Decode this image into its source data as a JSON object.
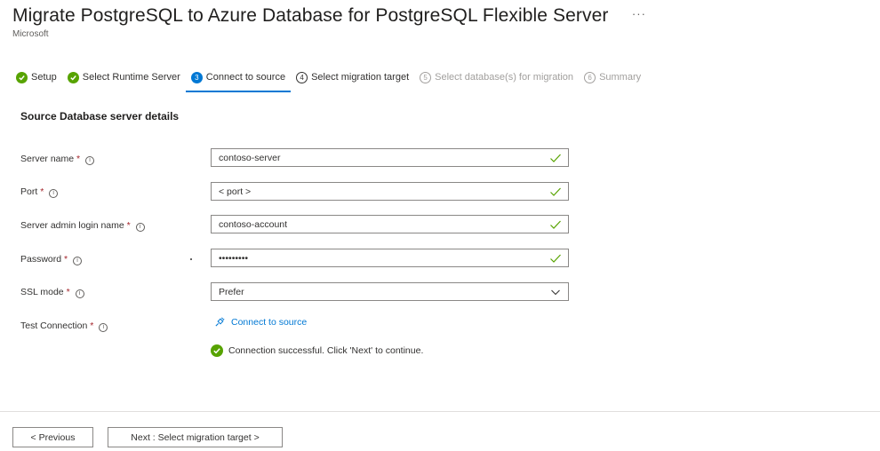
{
  "header": {
    "title": "Migrate PostgreSQL to Azure Database for PostgreSQL Flexible Server",
    "more": "···",
    "subtitle": "Microsoft"
  },
  "steps": [
    {
      "num": "1",
      "label": "Setup",
      "state": "done"
    },
    {
      "num": "2",
      "label": "Select Runtime Server",
      "state": "done"
    },
    {
      "num": "3",
      "label": "Connect to source",
      "state": "active"
    },
    {
      "num": "4",
      "label": "Select migration target",
      "state": "todo"
    },
    {
      "num": "5",
      "label": "Select database(s) for migration",
      "state": "disabled"
    },
    {
      "num": "6",
      "label": "Summary",
      "state": "disabled"
    }
  ],
  "section": {
    "title": "Source Database server details"
  },
  "form": {
    "required_mark": "*",
    "info_glyph": "i",
    "server_name": {
      "label": "Server name",
      "value": "contoso-server"
    },
    "port": {
      "label": "Port",
      "value": "< port >"
    },
    "admin_login": {
      "label": "Server admin login name",
      "value": "contoso-account"
    },
    "password": {
      "label": "Password",
      "value": "•••••••••"
    },
    "ssl_mode": {
      "label": "SSL mode",
      "value": "Prefer"
    },
    "test_connection": {
      "label": "Test Connection",
      "link_text": "Connect to source"
    }
  },
  "status": {
    "message": "Connection successful. Click 'Next' to continue."
  },
  "footer": {
    "previous_label": "< Previous",
    "next_label": "Next : Select migration target >"
  },
  "colors": {
    "accent": "#0078d4",
    "success": "#57a300",
    "required": "#a4262c"
  }
}
